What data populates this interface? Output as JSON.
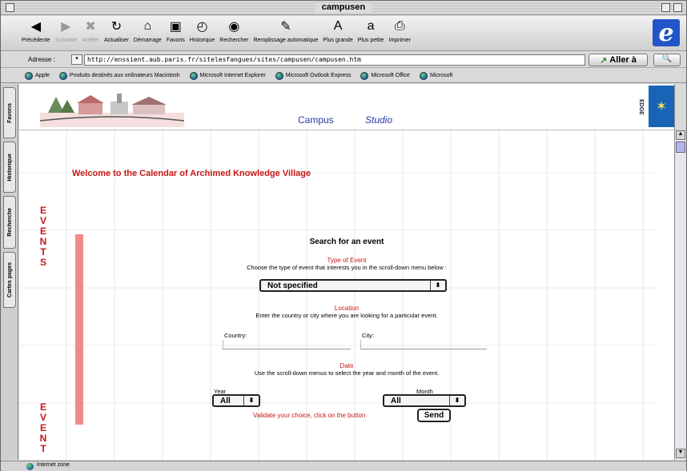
{
  "window": {
    "title": "campusen"
  },
  "toolbar": {
    "buttons": [
      {
        "label": "Précédente",
        "icon": "back-icon",
        "glyph": "◀",
        "enabled": true
      },
      {
        "label": "Suivante",
        "icon": "forward-icon",
        "glyph": "▶",
        "enabled": false
      },
      {
        "label": "Arrêter",
        "icon": "stop-icon",
        "glyph": "✖",
        "enabled": false
      },
      {
        "label": "Actualiser",
        "icon": "refresh-icon",
        "glyph": "↻",
        "enabled": true
      },
      {
        "label": "Démarrage",
        "icon": "home-icon",
        "glyph": "⌂",
        "enabled": true
      },
      {
        "label": "Favoris",
        "icon": "favorites-icon",
        "glyph": "▣",
        "enabled": true
      },
      {
        "label": "Historique",
        "icon": "history-icon",
        "glyph": "◴",
        "enabled": true
      },
      {
        "label": "Rechercher",
        "icon": "search-icon",
        "glyph": "◉",
        "enabled": true
      },
      {
        "label": "Remplissage automatique",
        "icon": "autofill-icon",
        "glyph": "✎",
        "enabled": true
      },
      {
        "label": "Plus grande",
        "icon": "larger-text-icon",
        "glyph": "A",
        "enabled": true
      },
      {
        "label": "Plus petite",
        "icon": "smaller-text-icon",
        "glyph": "a",
        "enabled": true
      },
      {
        "label": "Imprimer",
        "icon": "print-icon",
        "glyph": "⎙",
        "enabled": true
      }
    ],
    "ie_logo": "e"
  },
  "address": {
    "label": "Adresse :",
    "url": "http://enssient.aub.paris.fr/sitelesfangues/sites/campusen/campusen.htm",
    "go_label": "Aller à",
    "go_arrow": "↗",
    "search_glyph": "🔍"
  },
  "favorites": [
    "Apple",
    "Produits destinés aux ordinateurs Macintosh",
    "Microsoft Internet Explorer",
    "Microsoft Outlook Express",
    "Microsoft Office",
    "Microsoft"
  ],
  "side_tabs": [
    "Favoris",
    "Historique",
    "Recherche",
    "Cartes pages"
  ],
  "banner": {
    "nav_campus": "Campus",
    "nav_studio": "Studio",
    "edge_label": "EDGE",
    "flag_glyph": "✶"
  },
  "page": {
    "welcome": "Welcome to the Calendar of Archimed Knowledge Village",
    "events_letters": [
      "E",
      "V",
      "E",
      "N",
      "T",
      "S"
    ],
    "events_letters_bottom": [
      "E",
      "V",
      "E",
      "N",
      "T"
    ],
    "form_title": "Search for an event",
    "type_heading": "Type of Event",
    "type_text": "Choose the type of event that interests you in the scroll-down menu below :",
    "type_value": "Not specified",
    "location_heading": "Location",
    "location_text": "Enter the country or city where you are looking for a particular event.",
    "country_label": "Country:",
    "city_label": "City:",
    "date_heading": "Date",
    "date_text": "Use the scroll-down menus to select the year and month of the event.",
    "year_label": "Year",
    "year_value": "All",
    "month_label": "Month",
    "month_value": "All",
    "validate_text": "Validate your choice, click on the button",
    "send_label": "Send",
    "caret": "⬍"
  },
  "status": {
    "text": "Internet zone"
  },
  "colors": {
    "accent_red": "#c81818",
    "link_blue": "#2a3aa8",
    "bar_pink": "#f08a8a"
  }
}
